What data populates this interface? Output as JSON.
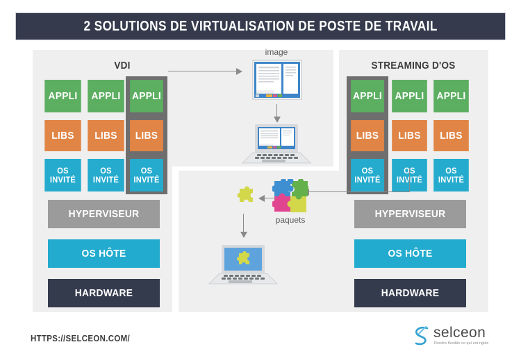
{
  "header": {
    "title": "2 SOLUTIONS DE VIRTUALISATION DE POSTE DE TRAVAIL"
  },
  "panels": {
    "left": {
      "title": "VDI",
      "columns": [
        {
          "appli": "APPLI",
          "libs": "LIBS",
          "os_line1": "OS",
          "os_line2": "INVITÉ",
          "highlighted": false
        },
        {
          "appli": "APPLI",
          "libs": "LIBS",
          "os_line1": "OS",
          "os_line2": "INVITÉ",
          "highlighted": false
        },
        {
          "appli": "APPLI",
          "libs": "LIBS",
          "os_line1": "OS",
          "os_line2": "INVITÉ",
          "highlighted": true
        }
      ],
      "hypervisor": "HYPERVISEUR",
      "host_os": "OS HÔTE",
      "hardware": "HARDWARE"
    },
    "right": {
      "title": "STREAMING D'OS",
      "columns": [
        {
          "appli": "APPLI",
          "libs": "LIBS",
          "os_line1": "OS",
          "os_line2": "INVITÉ",
          "highlighted": true
        },
        {
          "appli": "APPLI",
          "libs": "LIBS",
          "os_line1": "OS",
          "os_line2": "INVITÉ",
          "highlighted": false
        },
        {
          "appli": "APPLI",
          "libs": "LIBS",
          "os_line1": "OS",
          "os_line2": "INVITÉ",
          "highlighted": false
        }
      ],
      "hypervisor": "HYPERVISEUR",
      "host_os": "OS HÔTE",
      "hardware": "HARDWARE"
    },
    "center_top": {
      "caption": "image"
    },
    "center_bottom": {
      "caption": "paquets"
    }
  },
  "footer": {
    "url": "HTTPS://SELCEON.COM/",
    "logo_name": "selceon",
    "logo_tagline": "Rendre flexible ce qui est rigide"
  },
  "colors": {
    "title_bar": "#353b4d",
    "panel_bg": "#efefef",
    "appli_green": "#5cae61",
    "libs_orange": "#e08545",
    "os_cyan": "#25abce",
    "hypervisor_gray": "#9b9b9b",
    "host_os_cyan": "#22abce",
    "hardware_navy": "#343b4d",
    "highlight_frame": "#6e6e6e",
    "arrow_gray": "#8a8a8a",
    "logo_blue": "#2f9fd0"
  }
}
